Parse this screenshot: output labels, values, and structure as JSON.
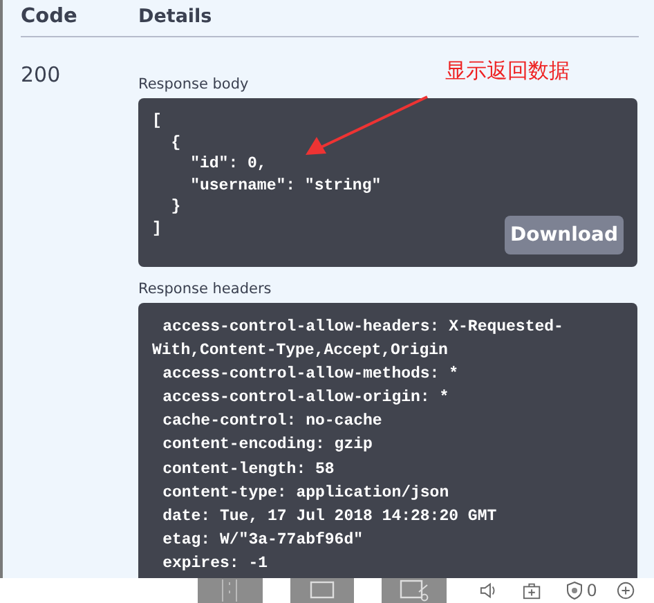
{
  "columns": [
    "Code",
    "Details"
  ],
  "responses": [
    {
      "code": "200",
      "body_label": "Response body",
      "body": "[\n  {\n    \"id\": 0,\n    \"username\": \"string\"\n  }\n]",
      "download": "Download",
      "headers_label": "Response headers",
      "headers": [
        "access-control-allow-headers: X-Requested-With,Content-Type,Accept,Origin",
        "access-control-allow-methods: *",
        "access-control-allow-origin: *",
        "cache-control: no-cache",
        "content-encoding: gzip",
        "content-length: 58",
        "content-type: application/json",
        "date: Tue, 17 Jul 2018 14:28:20 GMT",
        "etag: W/\"3a-77abf96d\"",
        "expires: -1"
      ]
    }
  ],
  "annotation": "显示返回数据",
  "status_bar": {
    "blocked_count": "0"
  }
}
